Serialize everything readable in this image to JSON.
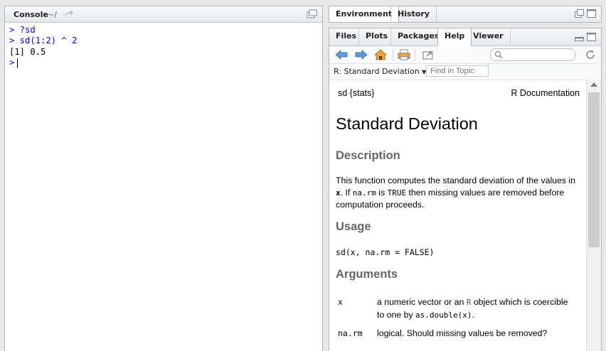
{
  "console": {
    "title": "Console",
    "path": "~/",
    "lines": [
      {
        "prompt": ">",
        "text": " ?sd"
      },
      {
        "prompt": ">",
        "text": " sd(1:2) ^ 2"
      },
      {
        "output": "[1] 0.5"
      },
      {
        "prompt": ">",
        "text": " "
      }
    ]
  },
  "env": {
    "tabs": [
      "Environment",
      "History"
    ]
  },
  "help": {
    "tabs": [
      "Files",
      "Plots",
      "Packages",
      "Help",
      "Viewer"
    ],
    "active_tab": "Help",
    "topic_select": "R: Standard Deviation",
    "find_placeholder": "Find in Topic",
    "search_placeholder": "",
    "doc": {
      "header_left": "sd {stats}",
      "header_right": "R Documentation",
      "title": "Standard Deviation",
      "sections": {
        "description": "Description",
        "usage": "Usage",
        "arguments": "Arguments"
      },
      "description_text": {
        "p1": "This function computes the standard deviation of the values in",
        "x": "x",
        "p2": ". If",
        "narm": "na.rm",
        "p3": "is",
        "true": "TRUE",
        "p4": "then missing values are removed before computation proceeds."
      },
      "usage_code": "sd(x, na.rm = FALSE)",
      "args": [
        {
          "name": "x",
          "desc_a": "a numeric vector or an",
          "desc_r": "R",
          "desc_b": "object which is coercible to one by",
          "desc_code": "as.double(x)",
          "desc_end": "."
        },
        {
          "name": "na.rm",
          "desc": "logical. Should missing values be removed?"
        }
      ]
    }
  },
  "colors": {
    "prompt": "#0000ff",
    "section": "#666666"
  }
}
